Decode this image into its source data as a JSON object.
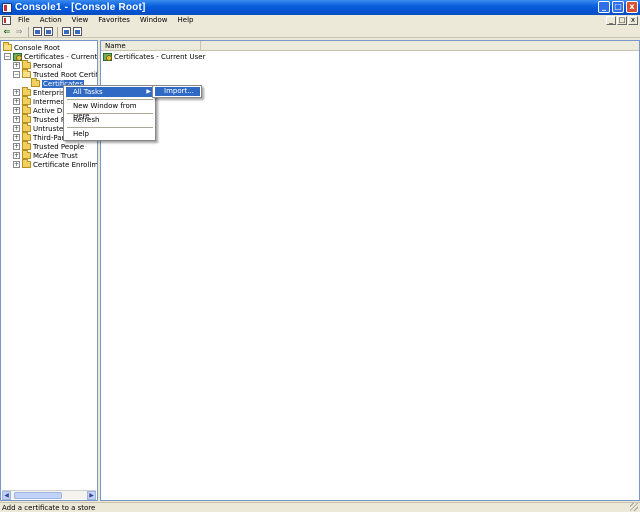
{
  "window": {
    "title": "Console1 - [Console Root]",
    "controls": {
      "minimize": "_",
      "maximize": "□",
      "close": "x"
    }
  },
  "menu": {
    "items": [
      "File",
      "Action",
      "View",
      "Favorites",
      "Window",
      "Help"
    ]
  },
  "toolbar": {
    "icons": [
      "back-arrow-icon",
      "forward-arrow-icon",
      "show-hide-tree-icon",
      "export-list-icon",
      "properties-icon",
      "help-icon"
    ]
  },
  "tree": {
    "root": "Console Root",
    "store": "Certificates - Current User",
    "nodes": [
      {
        "label": "Personal",
        "expander": "+"
      },
      {
        "label": "Trusted Root Certificat",
        "expander": "−"
      },
      {
        "label": "Certificates",
        "expander": "",
        "selected": true
      },
      {
        "label": "Enterprise",
        "expander": "+"
      },
      {
        "label": "Intermedia",
        "expander": "+"
      },
      {
        "label": "Active Dire",
        "expander": "+"
      },
      {
        "label": "Trusted Pu",
        "expander": "+"
      },
      {
        "label": "Untrusted",
        "expander": "+"
      },
      {
        "label": "Third-Part",
        "expander": "+"
      },
      {
        "label": "Trusted People",
        "expander": "+"
      },
      {
        "label": "McAfee Trust",
        "expander": "+"
      },
      {
        "label": "Certificate Enrollment R",
        "expander": "+"
      }
    ]
  },
  "list": {
    "column_name": "Name",
    "items": [
      "Certificates - Current User"
    ]
  },
  "context_menu": {
    "all_tasks": "All Tasks",
    "new_window": "New Window from Here",
    "refresh": "Refresh",
    "help": "Help",
    "submenu_import": "Import..."
  },
  "status": {
    "text": "Add a certificate to a store"
  }
}
